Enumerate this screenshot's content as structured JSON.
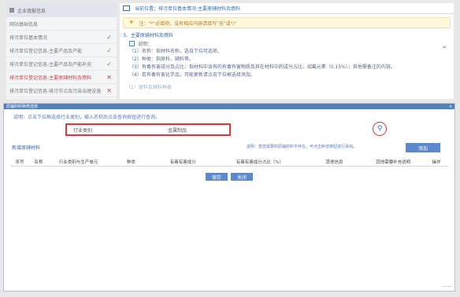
{
  "sidebar": {
    "title": "企业填报信息",
    "items": [
      {
        "label": "网站基础信息",
        "status": ""
      },
      {
        "label": "排污单位基本情况",
        "status": "ok"
      },
      {
        "label": "排污单位登记信息-主要产品及产能",
        "status": "ok"
      },
      {
        "label": "排污单位登记信息-主要产品及产能补充",
        "status": "ok"
      },
      {
        "label": "排污单位登记信息-主要原辅材料及燃料",
        "status": "no"
      },
      {
        "label": "排污单位登记信息-排污节点及污染治理设施",
        "status": "no"
      }
    ]
  },
  "main": {
    "breadcrumb": "当前位置：排污单位基本情况-主要原辅材料及燃料",
    "tip": "注：\"*\"必填项，没有相应内容请填写\"无\"或\"/\"",
    "section_title": "3、主要原辅材料及燃料",
    "sub_title": "说明：",
    "desc": [
      "（1）名称：指材料名称，选自下拉可选项。",
      "（2）种类：指原料、辅料等。",
      "（3）有毒有害成分及占比：指材料中含有的有毒有害物质及其在材料中的成分占比，如氟元素（0.15%）；其他需备注的内容。",
      "（4）若有毒有害化学品，可能更新请点击下拉框选择添加。"
    ],
    "fold_label": "（1）原料及辅料种类"
  },
  "dialog": {
    "title": "原辅材料种类选择",
    "close": "×",
    "note": "说明：点击下拉框选择行业类别，输入名称后点击查询按钮进行查询。",
    "field_label": "行业类别",
    "field_value": "金属制品",
    "add_link": "新增原辅材料",
    "hint": "说明：若您需要的原辅材料不存在，可点击新增按钮进行添加。",
    "search_btn": "添加",
    "columns": [
      "序号",
      "名称",
      "行业类别与生产单元",
      "种类",
      "有毒有害成分",
      "有毒有害成分占比（%）",
      "其他信息",
      "其他需要补充说明",
      "操作"
    ],
    "save": "保存",
    "close_btn": "关闭",
    "corner": "——"
  }
}
